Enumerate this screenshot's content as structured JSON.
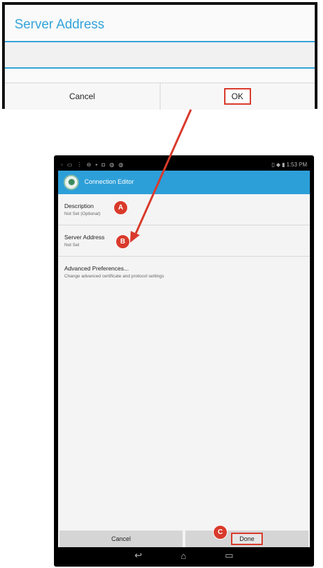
{
  "dialog": {
    "title": "Server Address",
    "cancel_label": "Cancel",
    "ok_label": "OK"
  },
  "phone": {
    "status_left_icons": "◦ ▭ ⋮ ⊖ ▪ ◘ ◍ ◍",
    "status_right": "▯ ◆ ▮ 1:53 PM",
    "app_title": "Connection Editor",
    "prefs": [
      {
        "title": "Description",
        "subtitle": "Not Set (Optional)"
      },
      {
        "title": "Server Address",
        "subtitle": "Not Set"
      },
      {
        "title": "Advanced Preferences...",
        "subtitle": "Change advanced certificate and protocol settings"
      }
    ],
    "cancel_label": "Cancel",
    "done_label": "Done",
    "nav": {
      "back": "↩",
      "home": "⌂",
      "recents": "▭"
    }
  },
  "badges": {
    "a": "A",
    "b": "B",
    "c": "C"
  },
  "colors": {
    "accent": "#2d9fd8",
    "callout": "#d93a2b",
    "title_blue": "#33a3d9"
  },
  "icons": [
    "app-logo-icon",
    "back-icon",
    "home-icon",
    "recents-icon",
    "callout-arrow-icon"
  ]
}
